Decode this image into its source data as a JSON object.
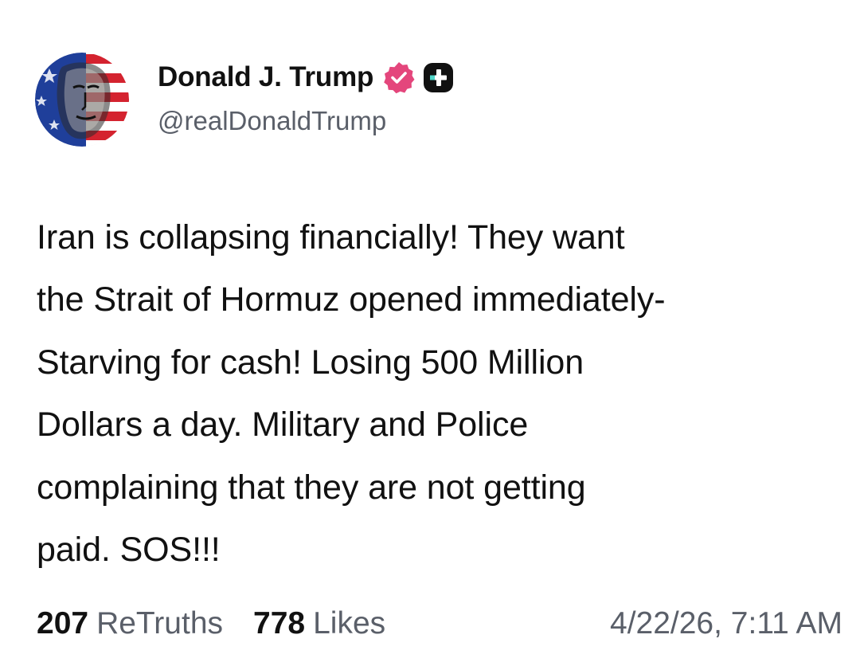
{
  "author": {
    "display_name": "Donald J. Trump",
    "handle": "@realDonaldTrump",
    "avatar_icon": "avatar-portrait-flag",
    "verified_icon": "verified-badge-icon",
    "verified_color": "#e4467c",
    "plus_icon": "plus-badge-icon"
  },
  "post": {
    "text": "Iran is collapsing financially! They want\nthe Strait of Hormuz opened immediately-\nStarving for cash! Losing 500 Million\nDollars a day. Military and Police\ncomplaining that they are not getting\npaid. SOS!!!"
  },
  "stats": {
    "retruths_count": "207",
    "retruths_label": "ReTruths",
    "likes_count": "778",
    "likes_label": "Likes"
  },
  "timestamp": "4/22/26, 7:11 AM",
  "colors": {
    "text": "#111111",
    "muted": "#5a5f69",
    "background": "#ffffff"
  }
}
